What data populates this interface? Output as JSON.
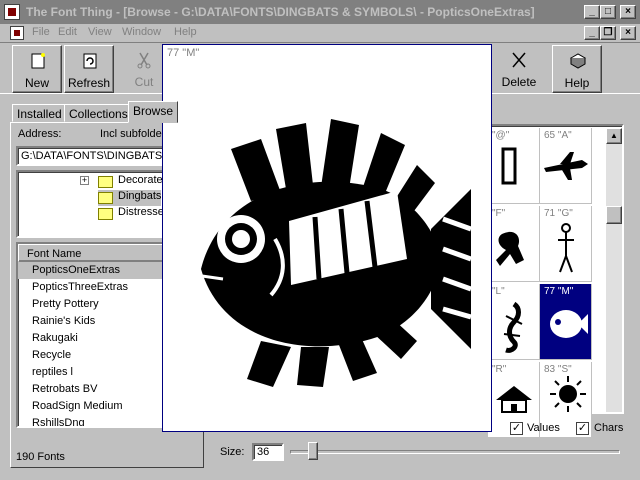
{
  "window": {
    "title": "The Font Thing - [Browse - G:\\DATA\\FONTS\\DINGBATS & SYMBOLS\\ - PopticsOneExtras]",
    "controls": [
      "_",
      "□",
      "×"
    ],
    "mdi_controls": [
      "_",
      "❐",
      "×"
    ]
  },
  "menu": [
    "File",
    "Edit",
    "View",
    "Window",
    "Help"
  ],
  "toolbar": {
    "new": "New",
    "refresh": "Refresh",
    "cut": "Cut",
    "delete": "Delete",
    "help": "Help"
  },
  "tabs": [
    "Installed",
    "Collections",
    "Browse"
  ],
  "browse": {
    "address_label": "Address:",
    "subfolders_label": "Incl subfolders",
    "address_value": "G:\\DATA\\FONTS\\DINGBATS & SYMBOLS\\",
    "tree": [
      "Decorated",
      "Dingbats",
      "Distressed"
    ],
    "tree_expander": "+"
  },
  "font_list": {
    "header": "Font Name",
    "items": [
      "PopticsOneExtras",
      "PopticsThreeExtras",
      "Pretty Pottery",
      "Rainie's Kids",
      "Rakugaki",
      "Recycle",
      "reptiles l",
      "Retrobats BV",
      "RoadSign Medium",
      "RshillsDng"
    ],
    "selected": "PopticsOneExtras",
    "count": "190 Fonts"
  },
  "grid": {
    "cells": [
      {
        "label": "\"@\""
      },
      {
        "label": "65 \"A\""
      },
      {
        "label": "\"F\""
      },
      {
        "label": "71 \"G\""
      },
      {
        "label": "\"L\""
      },
      {
        "label": "77 \"M\""
      },
      {
        "label": "\"R\""
      },
      {
        "label": "83 \"S\""
      }
    ],
    "selected": "77 \"M\""
  },
  "options": {
    "values_label": "Values",
    "chars_label": "Chars",
    "size_label": "Size:",
    "size_value": "36",
    "check_mark": "✓"
  },
  "preview": {
    "label": "77 \"M\""
  },
  "colors": {
    "selection": "#000080",
    "titlebar_inactive": "#808080"
  }
}
